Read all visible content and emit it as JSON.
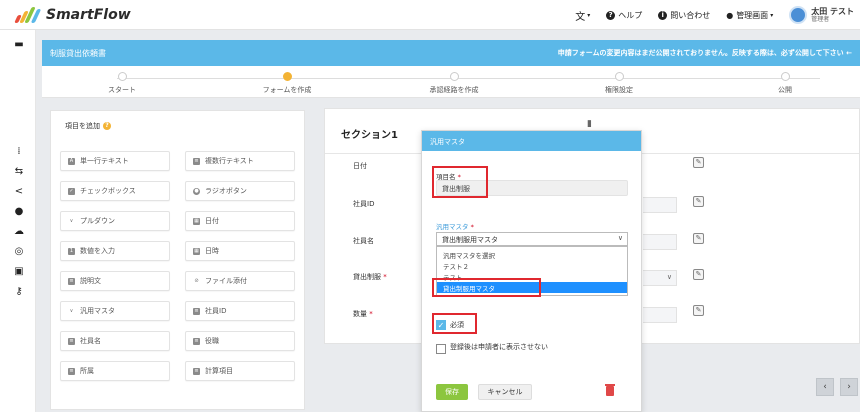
{
  "app": {
    "brand": "SmartFlow"
  },
  "topbar": {
    "menu": [
      {
        "icon": "translate-icon",
        "label": ""
      },
      {
        "icon": "help-icon",
        "label": "ヘルプ"
      },
      {
        "icon": "info-icon",
        "label": "問い合わせ"
      },
      {
        "icon": "user-icon",
        "label": "管理画面"
      }
    ],
    "user": {
      "name": "太田 テスト",
      "role": "管理者"
    }
  },
  "header": {
    "title": "制服貸出依頼書",
    "note": "申請フォームの変更内容はまだ公開されておりません。反映する際は、必ず公開して下さい ←"
  },
  "steps": [
    "スタート",
    "フォームを作成",
    "承認経路を作成",
    "権限設定",
    "公開"
  ],
  "add_panel": {
    "title": "項目を追加",
    "items": [
      {
        "label": "単一行テキスト",
        "icon": "text-icon"
      },
      {
        "label": "複数行テキスト",
        "icon": "multiline-icon"
      },
      {
        "label": "チェックボックス",
        "icon": "checkbox-icon"
      },
      {
        "label": "ラジオボタン",
        "icon": "radio-icon"
      },
      {
        "label": "プルダウン",
        "icon": "chevron-icon"
      },
      {
        "label": "日付",
        "icon": "calendar-icon"
      },
      {
        "label": "数値を入力",
        "icon": "number-icon"
      },
      {
        "label": "日時",
        "icon": "datetime-icon"
      },
      {
        "label": "説明文",
        "icon": "description-icon"
      },
      {
        "label": "ファイル添付",
        "icon": "attachment-icon"
      },
      {
        "label": "汎用マスタ",
        "icon": "chevron-icon"
      },
      {
        "label": "社員ID",
        "icon": "id-icon"
      },
      {
        "label": "社員名",
        "icon": "name-icon"
      },
      {
        "label": "役職",
        "icon": "position-icon"
      },
      {
        "label": "所属",
        "icon": "department-icon"
      },
      {
        "label": "計算項目",
        "icon": "calc-icon"
      }
    ]
  },
  "section": {
    "title": "セクション1",
    "rows": [
      {
        "label": "日付",
        "required": false
      },
      {
        "label": "社員ID",
        "required": false
      },
      {
        "label": "社員名",
        "required": false
      },
      {
        "label": "貸出制服",
        "required": true
      },
      {
        "label": "数量",
        "required": true
      }
    ],
    "required_mark": "*"
  },
  "popup": {
    "title": "汎用マスタ",
    "field_name_label": "項目名",
    "field_name_value": "貸出制服",
    "master_label": "汎用マスタ",
    "master_selected": "貸出制服用マスタ",
    "options": [
      "汎用マスタを選択",
      "テスト２",
      "テスト",
      "貸出制服用マスタ"
    ],
    "required_check_label": "必須",
    "required_checked": true,
    "hide_after_label": "登録後は申請者に表示させない",
    "hide_after_checked": false,
    "save_label": "保存",
    "cancel_label": "キャンセル",
    "required_mark": "*"
  },
  "colors": {
    "accent": "#5bb8e8",
    "save": "#8cc63f",
    "highlight": "#e0282f"
  }
}
